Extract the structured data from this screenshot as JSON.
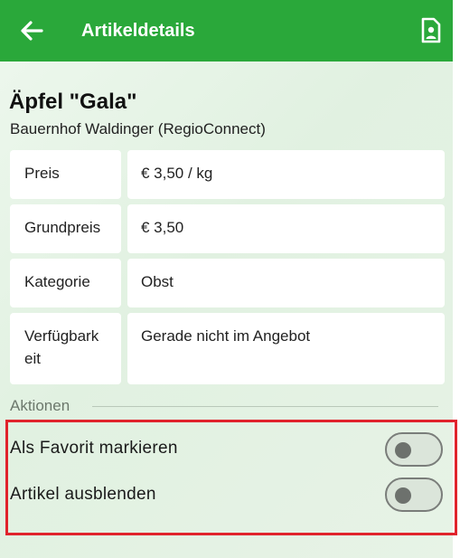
{
  "appbar": {
    "title": "Artikeldetails",
    "back_icon": "arrow-left-icon",
    "action_icon": "contact-card-icon",
    "color": "#2aa83a"
  },
  "product": {
    "name": "Äpfel \"Gala\"",
    "seller": "Bauernhof Waldinger (RegioConnect)"
  },
  "details": [
    {
      "label": "Preis",
      "value": "€ 3,50 / kg"
    },
    {
      "label": "Grundpreis",
      "value": "€ 3,50"
    },
    {
      "label": "Kategorie",
      "value": "Obst"
    },
    {
      "label": "Verfügbark\neit",
      "value": "Gerade nicht im Angebot"
    }
  ],
  "actions": {
    "section_label": "Aktionen",
    "favorite": {
      "label": "Als Favorit markieren",
      "on": false
    },
    "hide": {
      "label": "Artikel ausblenden",
      "on": false
    }
  },
  "highlight_color": "#e0232c"
}
